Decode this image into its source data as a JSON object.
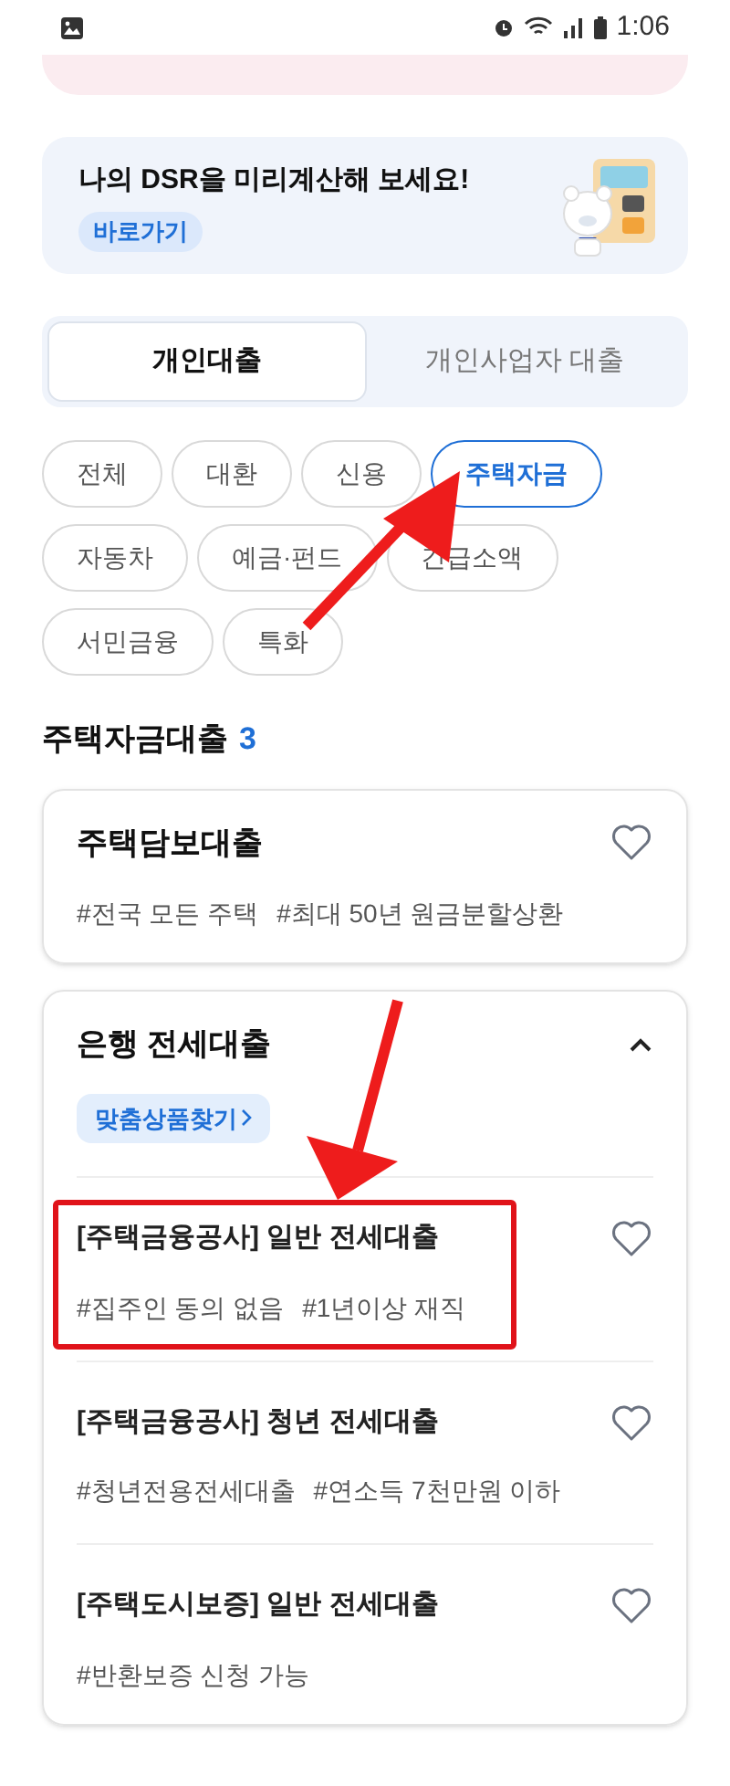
{
  "status_bar": {
    "time": "1:06"
  },
  "banner": {
    "title": "나의 DSR을 미리계산해 보세요!",
    "link": "바로가기"
  },
  "tabs": [
    {
      "label": "개인대출",
      "selected": true
    },
    {
      "label": "개인사업자 대출",
      "selected": false
    }
  ],
  "filters": [
    {
      "label": "전체",
      "selected": false
    },
    {
      "label": "대환",
      "selected": false
    },
    {
      "label": "신용",
      "selected": false
    },
    {
      "label": "주택자금",
      "selected": true
    },
    {
      "label": "자동차",
      "selected": false
    },
    {
      "label": "예금·펀드",
      "selected": false
    },
    {
      "label": "긴급소액",
      "selected": false
    },
    {
      "label": "서민금융",
      "selected": false
    },
    {
      "label": "특화",
      "selected": false
    }
  ],
  "section": {
    "title": "주택자금대출",
    "count": "3"
  },
  "cards": [
    {
      "title": "주택담보대출",
      "expanded": false,
      "tags": [
        "#전국 모든 주택",
        "#최대 50년 원금분할상환"
      ]
    },
    {
      "title": "은행 전세대출",
      "expanded": true,
      "link": "맞춤상품찾기",
      "items": [
        {
          "title": "[주택금융공사] 일반 전세대출",
          "tags": [
            "#집주인 동의 없음",
            "#1년이상 재직"
          ],
          "highlighted": true
        },
        {
          "title": "[주택금융공사] 청년 전세대출",
          "tags": [
            "#청년전용전세대출",
            "#연소득 7천만원 이하"
          ],
          "highlighted": false
        },
        {
          "title": "[주택도시보증] 일반 전세대출",
          "tags": [
            "#반환보증 신청 가능"
          ],
          "highlighted": false
        }
      ]
    }
  ]
}
